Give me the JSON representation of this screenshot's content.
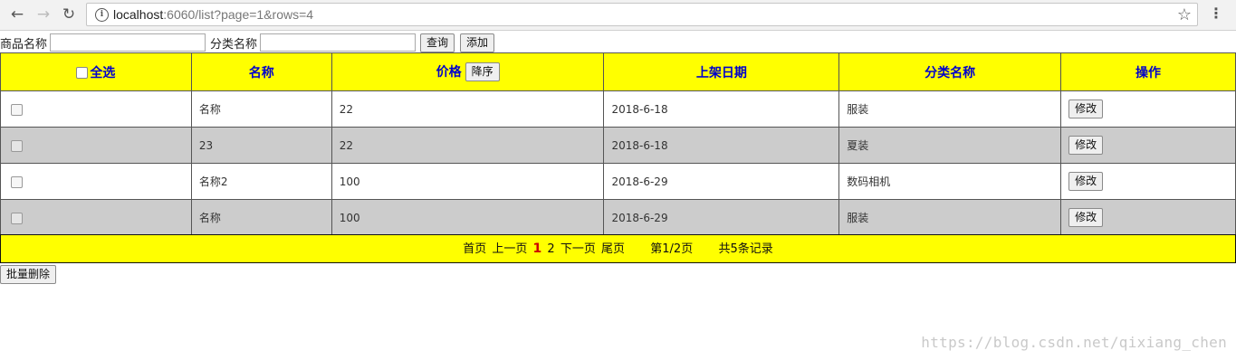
{
  "browser": {
    "url_host": "localhost",
    "url_rest": ":6060/list?page=1&rows=4"
  },
  "search": {
    "name_label": "商品名称",
    "name_value": "",
    "category_label": "分类名称",
    "category_value": "",
    "query_button": "查询",
    "add_button": "添加"
  },
  "table": {
    "headers": {
      "select_all": "全选",
      "name": "名称",
      "price": "价格",
      "sort_button": "降序",
      "date": "上架日期",
      "category": "分类名称",
      "action": "操作"
    },
    "edit_label": "修改",
    "rows": [
      {
        "name": "名称",
        "price": "22",
        "date": "2018-6-18",
        "category": "服装"
      },
      {
        "name": "23",
        "price": "22",
        "date": "2018-6-18",
        "category": "夏装"
      },
      {
        "name": "名称2",
        "price": "100",
        "date": "2018-6-29",
        "category": "数码相机"
      },
      {
        "name": "名称",
        "price": "100",
        "date": "2018-6-29",
        "category": "服装"
      }
    ]
  },
  "pager": {
    "first": "首页",
    "prev": "上一页",
    "page1": "1",
    "page2": "2",
    "next": "下一页",
    "last": "尾页",
    "page_info": "第1/2页",
    "total_info": "共5条记录"
  },
  "batch_delete": "批量删除",
  "watermark": "https://blog.csdn.net/qixiang_chen",
  "colors": {
    "header_bg": "#ffff00",
    "header_text": "#0000cc",
    "alt_row_bg": "#cccccc",
    "current_page": "#cc0000"
  }
}
